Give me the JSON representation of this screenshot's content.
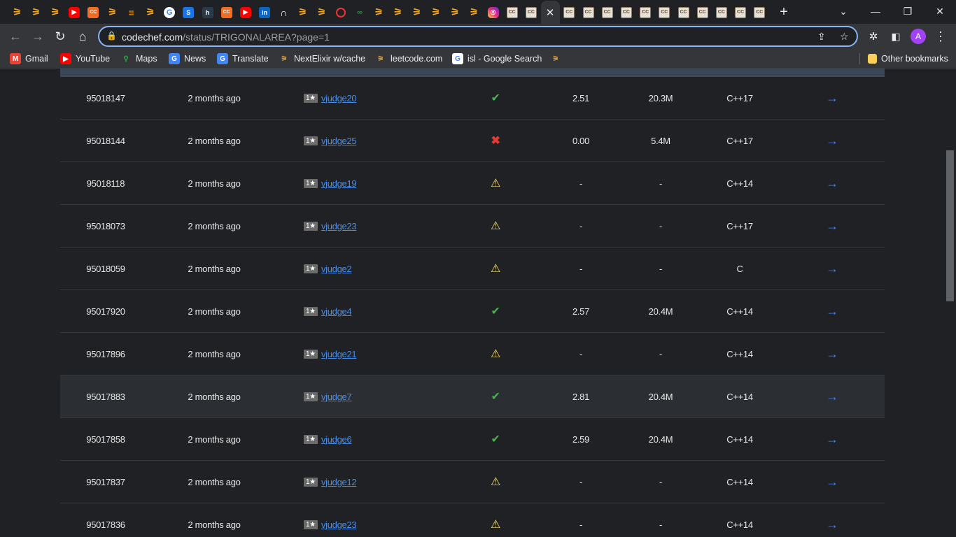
{
  "browser": {
    "tabs_favicons": [
      "codeforces",
      "codeforces",
      "codeforces",
      "youtube",
      "codechef-orange",
      "codeforces",
      "stackoverflow",
      "codeforces",
      "google",
      "blue-s",
      "hn",
      "codechef-orange",
      "youtube",
      "linkedin",
      "notion",
      "codeforces",
      "codeforces",
      "quora",
      "gfg",
      "codeforces",
      "codeforces",
      "codeforces",
      "codeforces",
      "codeforces",
      "codeforces",
      "instagram",
      "codechef",
      "codechef",
      "active",
      "codechef",
      "codechef",
      "codechef",
      "codechef",
      "codechef",
      "codechef",
      "codechef",
      "codechef",
      "codechef",
      "codechef",
      "codechef"
    ],
    "new_tab_label": "+",
    "url_host": "codechef.com",
    "url_path": "/status/TRIGONALAREA?page=1",
    "avatar_letter": "A",
    "bookmarks": [
      {
        "label": "Gmail",
        "icon": "gmail-icon"
      },
      {
        "label": "YouTube",
        "icon": "youtube-icon"
      },
      {
        "label": "Maps",
        "icon": "maps-icon"
      },
      {
        "label": "News",
        "icon": "news-icon"
      },
      {
        "label": "Translate",
        "icon": "translate-icon"
      },
      {
        "label": "NextElixir w/cache",
        "icon": "codeforces-icon"
      },
      {
        "label": "leetcode.com",
        "icon": "codeforces-icon"
      },
      {
        "label": "isl - Google Search",
        "icon": "google-icon"
      }
    ],
    "other_bookmarks": "Other bookmarks"
  },
  "submissions": [
    {
      "id": "95018147",
      "time": "2 months ago",
      "stars": "1★",
      "user": "vjudge20",
      "result": "ok",
      "exec": "2.51",
      "mem": "20.3M",
      "lang": "C++17"
    },
    {
      "id": "95018144",
      "time": "2 months ago",
      "stars": "1★",
      "user": "vjudge25",
      "result": "bad",
      "exec": "0.00",
      "mem": "5.4M",
      "lang": "C++17"
    },
    {
      "id": "95018118",
      "time": "2 months ago",
      "stars": "1★",
      "user": "vjudge19",
      "result": "warn",
      "exec": "-",
      "mem": "-",
      "lang": "C++14"
    },
    {
      "id": "95018073",
      "time": "2 months ago",
      "stars": "1★",
      "user": "vjudge23",
      "result": "warn",
      "exec": "-",
      "mem": "-",
      "lang": "C++17"
    },
    {
      "id": "95018059",
      "time": "2 months ago",
      "stars": "1★",
      "user": "vjudge2",
      "result": "warn",
      "exec": "-",
      "mem": "-",
      "lang": "C"
    },
    {
      "id": "95017920",
      "time": "2 months ago",
      "stars": "1★",
      "user": "vjudge4",
      "result": "ok",
      "exec": "2.57",
      "mem": "20.4M",
      "lang": "C++14"
    },
    {
      "id": "95017896",
      "time": "2 months ago",
      "stars": "1★",
      "user": "vjudge21",
      "result": "warn",
      "exec": "-",
      "mem": "-",
      "lang": "C++14"
    },
    {
      "id": "95017883",
      "time": "2 months ago",
      "stars": "1★",
      "user": "vjudge7",
      "result": "ok",
      "exec": "2.81",
      "mem": "20.4M",
      "lang": "C++14"
    },
    {
      "id": "95017858",
      "time": "2 months ago",
      "stars": "1★",
      "user": "vjudge6",
      "result": "ok",
      "exec": "2.59",
      "mem": "20.4M",
      "lang": "C++14"
    },
    {
      "id": "95017837",
      "time": "2 months ago",
      "stars": "1★",
      "user": "vjudge12",
      "result": "warn",
      "exec": "-",
      "mem": "-",
      "lang": "C++14"
    },
    {
      "id": "95017836",
      "time": "2 months ago",
      "stars": "1★",
      "user": "vjudge23",
      "result": "warn",
      "exec": "-",
      "mem": "-",
      "lang": "C++14"
    }
  ],
  "highlighted_row_index": 7,
  "colors": {
    "accent": "#8ab4f8",
    "link": "#4a8de8",
    "ok": "#4caf50",
    "bad": "#e53935",
    "warn": "#f5d96b"
  }
}
